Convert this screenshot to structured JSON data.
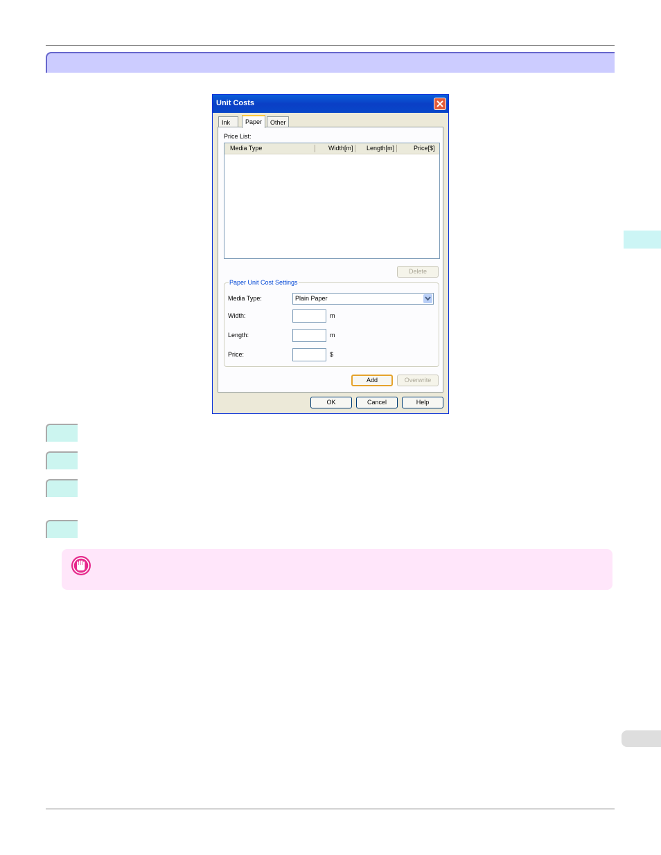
{
  "dialog": {
    "title": "Unit Costs",
    "tabs": [
      {
        "label": "Ink"
      },
      {
        "label": "Paper"
      },
      {
        "label": "Other"
      }
    ],
    "price_list": {
      "label": "Price List:",
      "columns": [
        "Media Type",
        "Width[m]",
        "Length[m]",
        "Price[$]"
      ],
      "rows": []
    },
    "delete_label": "Delete",
    "settings": {
      "title": "Paper Unit Cost Settings",
      "media_type_label": "Media Type:",
      "media_type_value": "Plain Paper",
      "width_label": "Width:",
      "width_value": "",
      "width_unit": "m",
      "length_label": "Length:",
      "length_value": "",
      "length_unit": "m",
      "price_label": "Price:",
      "price_value": "",
      "price_unit": "$"
    },
    "add_label": "Add",
    "overwrite_label": "Overwrite",
    "ok_label": "OK",
    "cancel_label": "Cancel",
    "help_label": "Help"
  },
  "colors": {
    "section_bar": "#ccccff",
    "step_box": "#ccf5f0",
    "note_bg": "#ffe6fa",
    "important_icon": "#e6288c"
  }
}
